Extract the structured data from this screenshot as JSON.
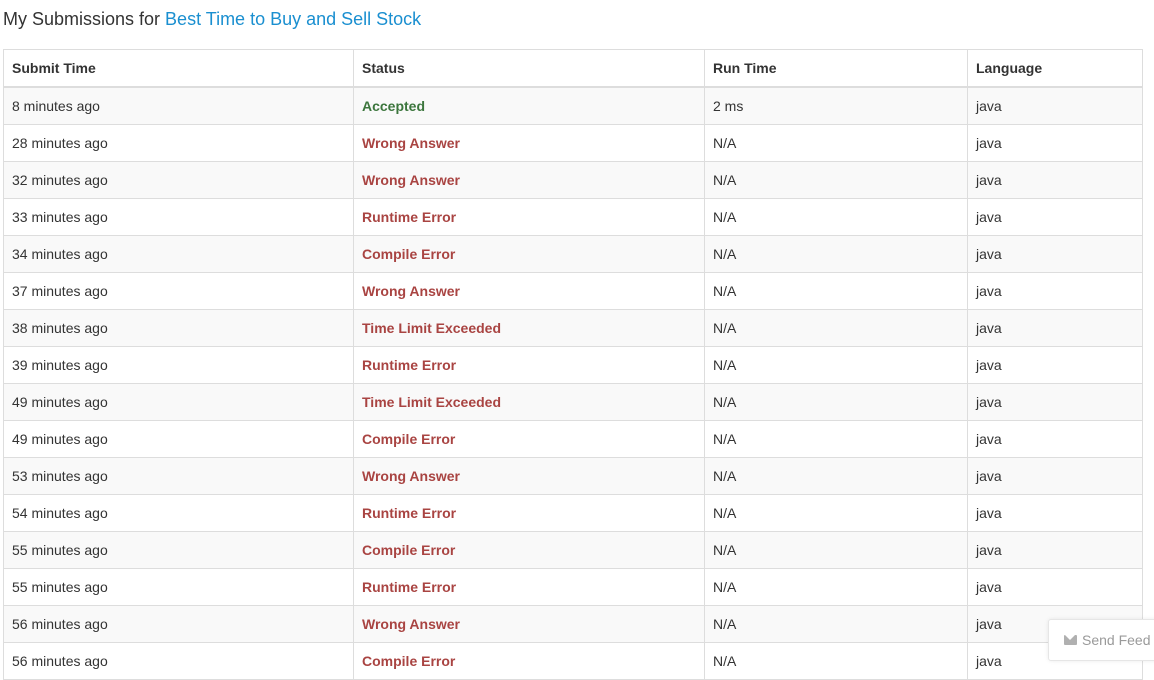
{
  "header": {
    "prefix": "My Submissions for ",
    "problem_link": "Best Time to Buy and Sell Stock"
  },
  "table": {
    "columns": [
      "Submit Time",
      "Status",
      "Run Time",
      "Language"
    ],
    "rows": [
      {
        "time": "8 minutes ago",
        "status": "Accepted",
        "runtime": "2 ms",
        "language": "java"
      },
      {
        "time": "28 minutes ago",
        "status": "Wrong Answer",
        "runtime": "N/A",
        "language": "java"
      },
      {
        "time": "32 minutes ago",
        "status": "Wrong Answer",
        "runtime": "N/A",
        "language": "java"
      },
      {
        "time": "33 minutes ago",
        "status": "Runtime Error",
        "runtime": "N/A",
        "language": "java"
      },
      {
        "time": "34 minutes ago",
        "status": "Compile Error",
        "runtime": "N/A",
        "language": "java"
      },
      {
        "time": "37 minutes ago",
        "status": "Wrong Answer",
        "runtime": "N/A",
        "language": "java"
      },
      {
        "time": "38 minutes ago",
        "status": "Time Limit Exceeded",
        "runtime": "N/A",
        "language": "java"
      },
      {
        "time": "39 minutes ago",
        "status": "Runtime Error",
        "runtime": "N/A",
        "language": "java"
      },
      {
        "time": "49 minutes ago",
        "status": "Time Limit Exceeded",
        "runtime": "N/A",
        "language": "java"
      },
      {
        "time": "49 minutes ago",
        "status": "Compile Error",
        "runtime": "N/A",
        "language": "java"
      },
      {
        "time": "53 minutes ago",
        "status": "Wrong Answer",
        "runtime": "N/A",
        "language": "java"
      },
      {
        "time": "54 minutes ago",
        "status": "Runtime Error",
        "runtime": "N/A",
        "language": "java"
      },
      {
        "time": "55 minutes ago",
        "status": "Compile Error",
        "runtime": "N/A",
        "language": "java"
      },
      {
        "time": "55 minutes ago",
        "status": "Runtime Error",
        "runtime": "N/A",
        "language": "java"
      },
      {
        "time": "56 minutes ago",
        "status": "Wrong Answer",
        "runtime": "N/A",
        "language": "java"
      },
      {
        "time": "56 minutes ago",
        "status": "Compile Error",
        "runtime": "N/A",
        "language": "java"
      }
    ]
  },
  "feedback": {
    "label": "Send Feed",
    "icon": "envelope-icon"
  },
  "colors": {
    "accepted": "#3c763d",
    "error": "#a94442",
    "link": "#1a8fd0"
  }
}
